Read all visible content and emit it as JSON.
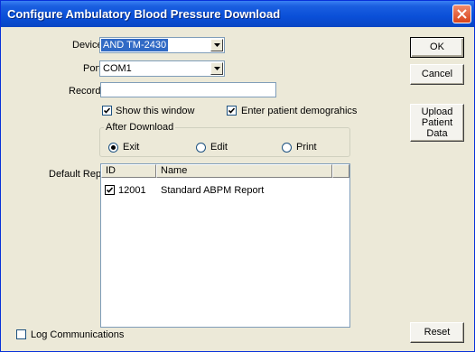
{
  "window": {
    "title": "Configure Ambulatory Blood Pressure Download"
  },
  "fields": {
    "device_label": "Device",
    "device_value": "AND TM-2430",
    "port_label": "Port",
    "port_value": "COM1",
    "record_label": "Record",
    "record_value": ""
  },
  "options": {
    "show_window": "Show this window",
    "show_window_checked": true,
    "enter_demographics": "Enter patient demograhics",
    "enter_demographics_checked": true
  },
  "after_download": {
    "label": "After Download",
    "options": [
      "Exit",
      "Edit",
      "Print"
    ],
    "selected": "Exit"
  },
  "report": {
    "label": "Default Repo",
    "columns": [
      "ID",
      "Name"
    ],
    "rows": [
      {
        "id": "12001",
        "name": "Standard ABPM Report",
        "checked": true
      }
    ]
  },
  "log": {
    "label": "Log Communications",
    "checked": false
  },
  "buttons": {
    "ok": "OK",
    "cancel": "Cancel",
    "upload_line1": "Upload",
    "upload_line2": "Patient",
    "upload_line3": "Data",
    "reset": "Reset"
  },
  "colors": {
    "titlebar": "#0a4fd8",
    "selection": "#316ac5",
    "face": "#ece9d8"
  }
}
